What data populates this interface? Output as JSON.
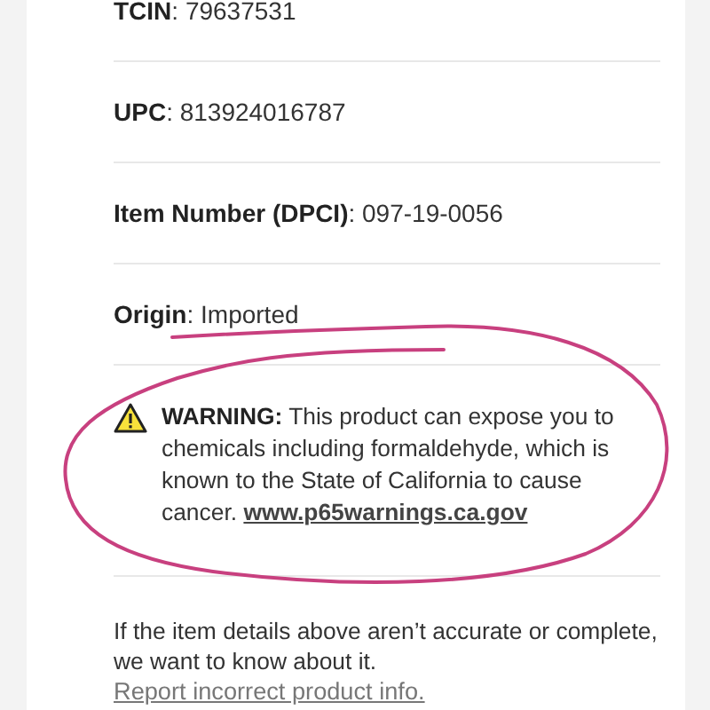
{
  "details": [
    "**TCIN**: 79637531",
    "**UPC**: 813924016787",
    "**Item Number (DPCI)**: 097-19-0056",
    "**Origin**: Imported"
  ],
  "warning": {
    "text": "**WARNING:** This product can expose you to chemicals including formaldehyde, which is known to the State of California to cause cancer.",
    "link": "www.p65warnings.ca.gov"
  },
  "feedback": {
    "text": "If the item details above aren’t accurate or complete, we want to know about it.",
    "link": "Report incorrect product info."
  }
}
